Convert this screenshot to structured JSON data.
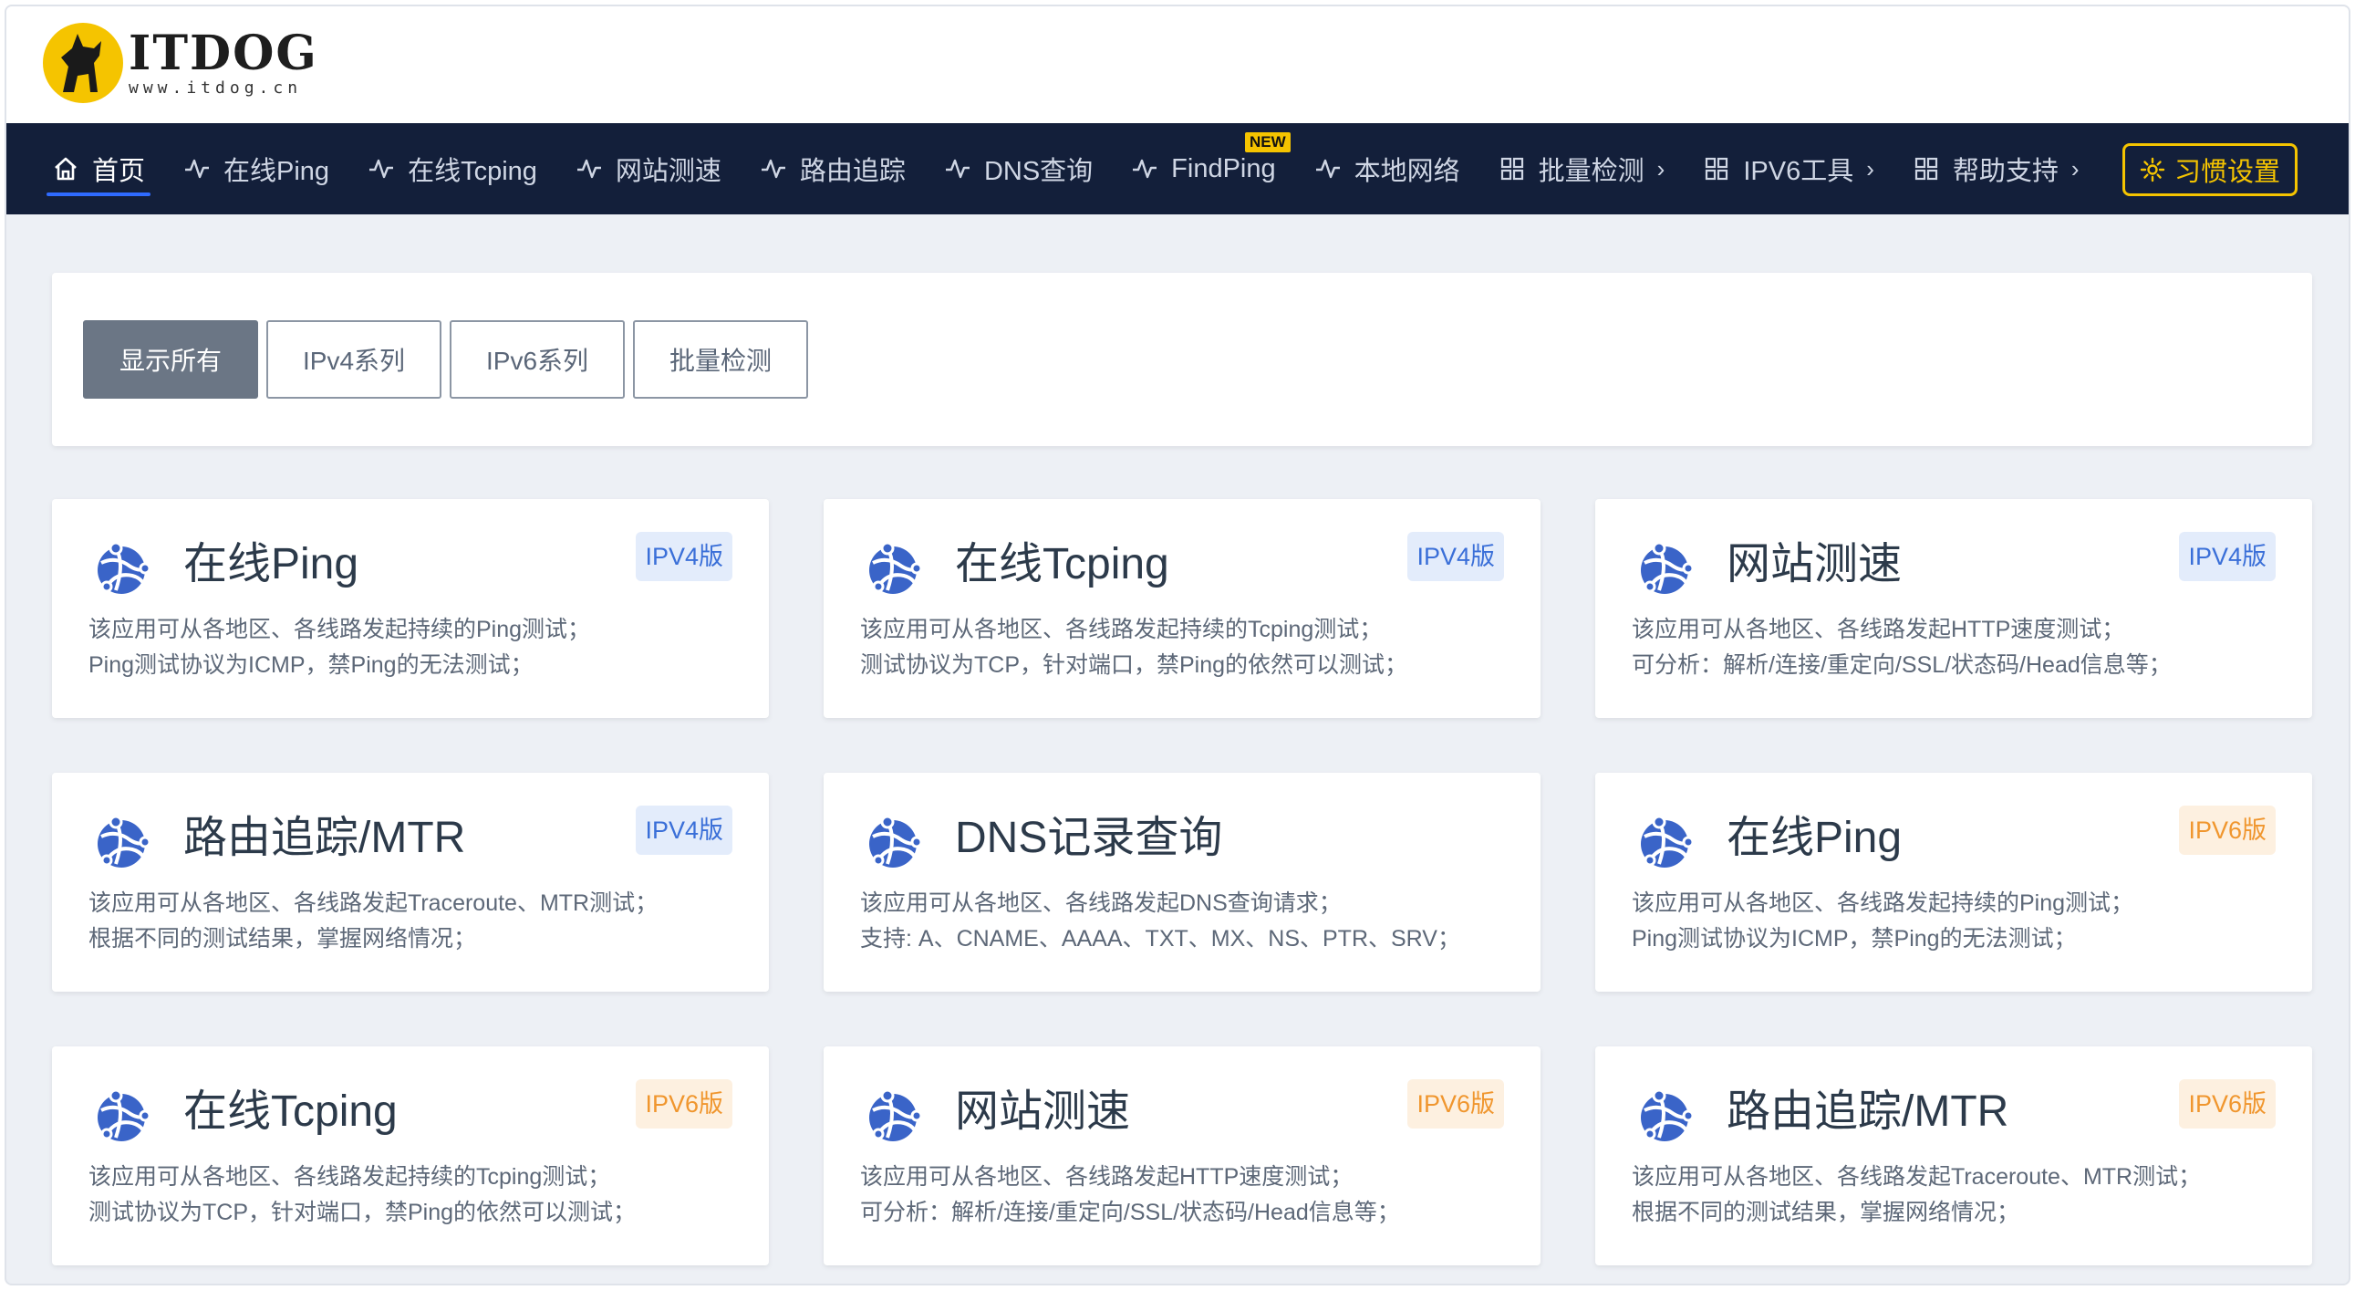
{
  "logo": {
    "title": "ITDOG",
    "url": "www.itdog.cn"
  },
  "nav": {
    "items": [
      {
        "label": "首页",
        "icon": "home-icon"
      },
      {
        "label": "在线Ping",
        "icon": "pulse-icon"
      },
      {
        "label": "在线Tcping",
        "icon": "pulse-icon"
      },
      {
        "label": "网站测速",
        "icon": "pulse-icon"
      },
      {
        "label": "路由追踪",
        "icon": "pulse-icon"
      },
      {
        "label": "DNS查询",
        "icon": "pulse-icon"
      },
      {
        "label": "FindPing",
        "icon": "pulse-icon",
        "badge": "NEW"
      },
      {
        "label": "本地网络",
        "icon": "pulse-icon"
      },
      {
        "label": "批量检测",
        "icon": "grid-icon"
      },
      {
        "label": "IPV6工具",
        "icon": "grid-icon"
      },
      {
        "label": "帮助支持",
        "icon": "grid-icon"
      }
    ],
    "settings_label": "习惯设置"
  },
  "filters": [
    "显示所有",
    "IPv4系列",
    "IPv6系列",
    "批量检测"
  ],
  "cards": [
    {
      "title": "在线Ping",
      "tag": "IPV4版",
      "desc1": "该应用可从各地区、各线路发起持续的Ping测试；",
      "desc2": "Ping测试协议为ICMP，禁Ping的无法测试；"
    },
    {
      "title": "在线Tcping",
      "tag": "IPV4版",
      "desc1": "该应用可从各地区、各线路发起持续的Tcping测试；",
      "desc2": "测试协议为TCP，针对端口，禁Ping的依然可以测试；"
    },
    {
      "title": "网站测速",
      "tag": "IPV4版",
      "desc1": "该应用可从各地区、各线路发起HTTP速度测试；",
      "desc2": "可分析：解析/连接/重定向/SSL/状态码/Head信息等；"
    },
    {
      "title": "路由追踪/MTR",
      "tag": "IPV4版",
      "desc1": "该应用可从各地区、各线路发起Traceroute、MTR测试；",
      "desc2": "根据不同的测试结果，掌握网络情况；"
    },
    {
      "title": "DNS记录查询",
      "tag": "",
      "desc1": "该应用可从各地区、各线路发起DNS查询请求；",
      "desc2": "支持: A、CNAME、AAAA、TXT、MX、NS、PTR、SRV；"
    },
    {
      "title": "在线Ping",
      "tag": "IPV6版",
      "desc1": "该应用可从各地区、各线路发起持续的Ping测试；",
      "desc2": "Ping测试协议为ICMP，禁Ping的无法测试；"
    },
    {
      "title": "在线Tcping",
      "tag": "IPV6版",
      "desc1": "该应用可从各地区、各线路发起持续的Tcping测试；",
      "desc2": "测试协议为TCP，针对端口，禁Ping的依然可以测试；"
    },
    {
      "title": "网站测速",
      "tag": "IPV6版",
      "desc1": "该应用可从各地区、各线路发起HTTP速度测试；",
      "desc2": "可分析：解析/连接/重定向/SSL/状态码/Head信息等；"
    },
    {
      "title": "路由追踪/MTR",
      "tag": "IPV6版",
      "desc1": "该应用可从各地区、各线路发起Traceroute、MTR测试；",
      "desc2": "根据不同的测试结果，掌握网络情况；"
    }
  ],
  "colors": {
    "nav_bg": "#131f3a",
    "accent_yellow": "#f5c400",
    "ipv4_tag": "#3a6fd8",
    "ipv6_tag": "#f0962e",
    "app_icon": "#3a64c8"
  }
}
